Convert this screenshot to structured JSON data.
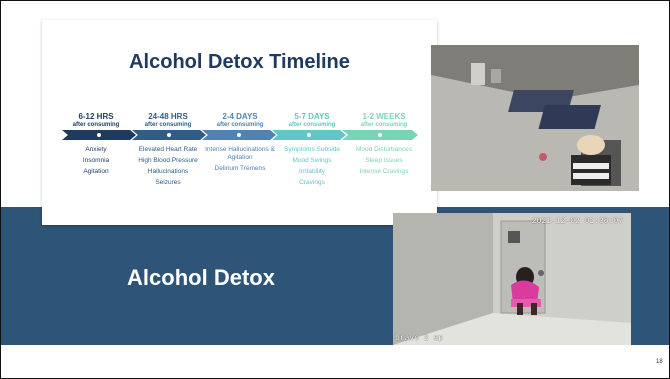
{
  "slide": {
    "title": "Alcohol Detox",
    "page_number": "18",
    "band_color": "#2e5478"
  },
  "timeline": {
    "title": "Alcohol Detox Timeline",
    "columns": [
      {
        "period": "6-12 HRS",
        "sub": "after consuming",
        "color": "#1e3a5f",
        "symptoms": [
          "Anxiety",
          "Insomnia",
          "Agitation"
        ]
      },
      {
        "period": "24-48 HRS",
        "sub": "after consuming",
        "color": "#2f5d8a",
        "symptoms": [
          "Elevated Heart Rate",
          "High Blood Pressure",
          "Hallucinations",
          "Seizures"
        ]
      },
      {
        "period": "2-4 DAYS",
        "sub": "after consuming",
        "color": "#4f82b5",
        "symptoms": [
          "Intense Hallucinations & Agitation",
          "Delirium Tremens"
        ]
      },
      {
        "period": "5-7 DAYS",
        "sub": "after consuming",
        "color": "#62c6c8",
        "symptoms": [
          "Symptoms Subside",
          "Mood Swings",
          "Irritability",
          "Cravings"
        ]
      },
      {
        "period": "1-2 WEEKS",
        "sub": "after consuming",
        "color": "#79d4b5",
        "symptoms": [
          "Mood Disturbances",
          "Sleep Issues",
          "Intense Cravings"
        ]
      }
    ]
  },
  "photos": {
    "top": {
      "alt": "cell-with-person-on-floor-photo"
    },
    "bottom": {
      "timestamp": "2021-12-02 01:38:07",
      "caption": "bravo 2 sp"
    }
  }
}
